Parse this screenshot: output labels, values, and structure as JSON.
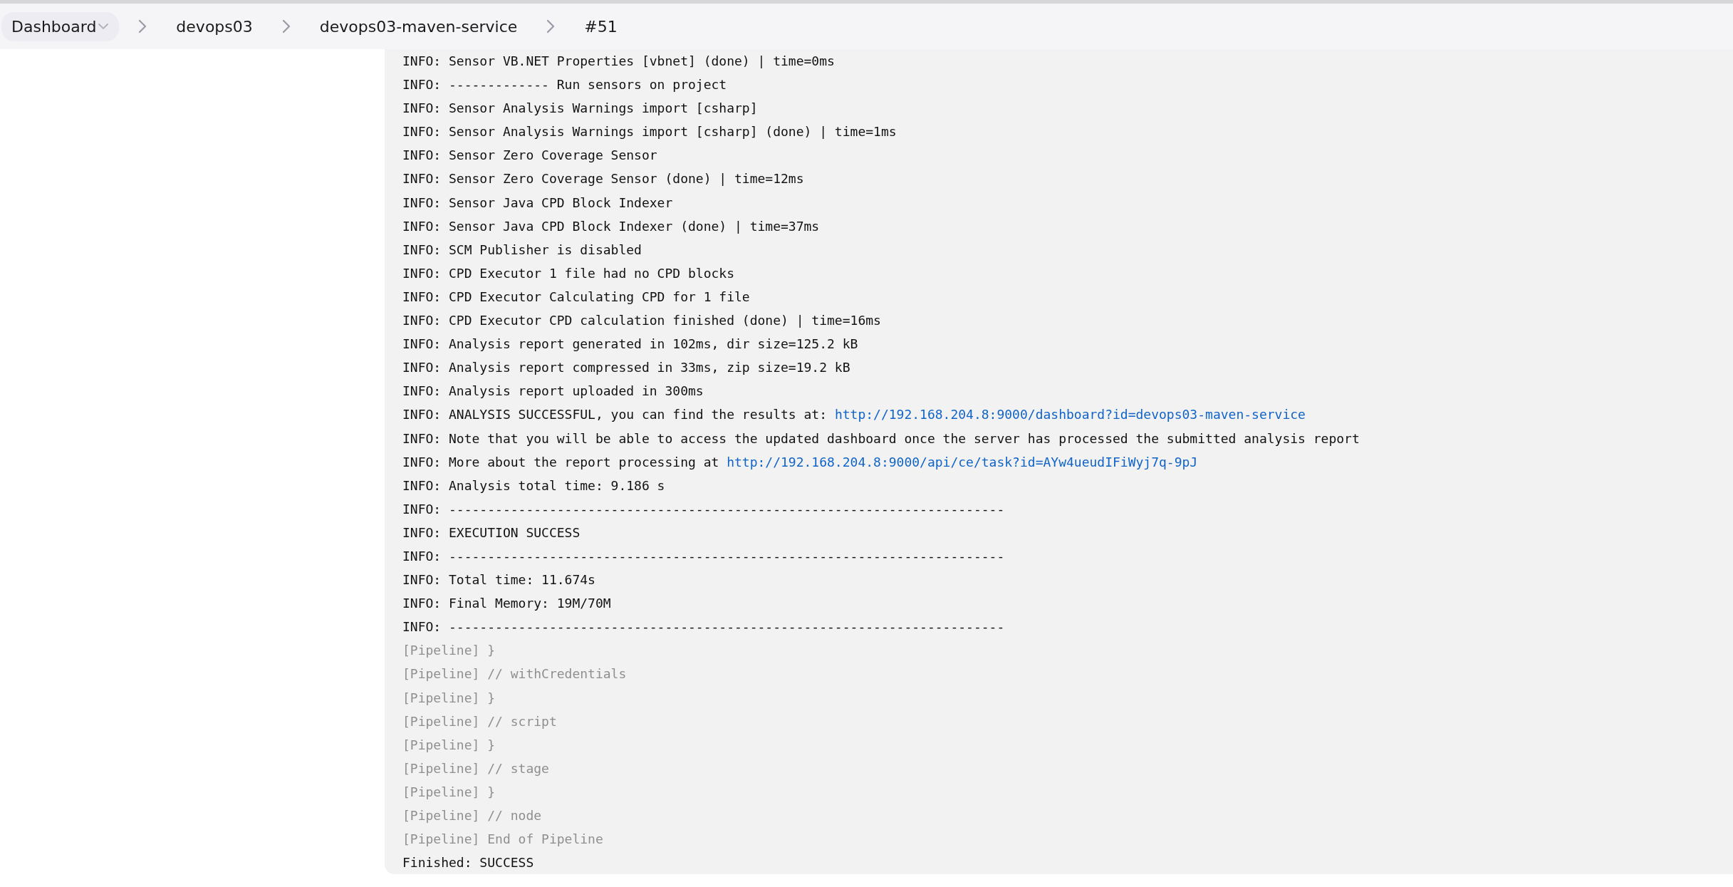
{
  "breadcrumb": [
    {
      "label": "Dashboard",
      "dropdown": true
    },
    {
      "label": "devops03",
      "dropdown": false
    },
    {
      "label": "devops03-maven-service",
      "dropdown": false
    },
    {
      "label": "#51",
      "dropdown": false
    }
  ],
  "console": {
    "lines": [
      {
        "kind": "output",
        "text": "INFO: Sensor VB.NET Properties [vbnet] (done) | time=0ms"
      },
      {
        "kind": "output",
        "text": "INFO: ------------- Run sensors on project"
      },
      {
        "kind": "output",
        "text": "INFO: Sensor Analysis Warnings import [csharp]"
      },
      {
        "kind": "output",
        "text": "INFO: Sensor Analysis Warnings import [csharp] (done) | time=1ms"
      },
      {
        "kind": "output",
        "text": "INFO: Sensor Zero Coverage Sensor"
      },
      {
        "kind": "output",
        "text": "INFO: Sensor Zero Coverage Sensor (done) | time=12ms"
      },
      {
        "kind": "output",
        "text": "INFO: Sensor Java CPD Block Indexer"
      },
      {
        "kind": "output",
        "text": "INFO: Sensor Java CPD Block Indexer (done) | time=37ms"
      },
      {
        "kind": "output",
        "text": "INFO: SCM Publisher is disabled"
      },
      {
        "kind": "output",
        "text": "INFO: CPD Executor 1 file had no CPD blocks"
      },
      {
        "kind": "output",
        "text": "INFO: CPD Executor Calculating CPD for 1 file"
      },
      {
        "kind": "output",
        "text": "INFO: CPD Executor CPD calculation finished (done) | time=16ms"
      },
      {
        "kind": "output",
        "text": "INFO: Analysis report generated in 102ms, dir size=125.2 kB"
      },
      {
        "kind": "output",
        "text": "INFO: Analysis report compressed in 33ms, zip size=19.2 kB"
      },
      {
        "kind": "output",
        "text": "INFO: Analysis report uploaded in 300ms"
      },
      {
        "kind": "output",
        "text": "INFO: ANALYSIS SUCCESSFUL, you can find the results at: ",
        "link": "http://192.168.204.8:9000/dashboard?id=devops03-maven-service"
      },
      {
        "kind": "output",
        "text": "INFO: Note that you will be able to access the updated dashboard once the server has processed the submitted analysis report"
      },
      {
        "kind": "output",
        "text": "INFO: More about the report processing at ",
        "link": "http://192.168.204.8:9000/api/ce/task?id=AYw4ueudIFiWyj7q-9pJ"
      },
      {
        "kind": "output",
        "text": "INFO: Analysis total time: 9.186 s"
      },
      {
        "kind": "output",
        "text": "INFO: ------------------------------------------------------------------------"
      },
      {
        "kind": "output",
        "text": "INFO: EXECUTION SUCCESS"
      },
      {
        "kind": "output",
        "text": "INFO: ------------------------------------------------------------------------"
      },
      {
        "kind": "output",
        "text": "INFO: Total time: 11.674s"
      },
      {
        "kind": "output",
        "text": "INFO: Final Memory: 19M/70M"
      },
      {
        "kind": "output",
        "text": "INFO: ------------------------------------------------------------------------"
      },
      {
        "kind": "pipeline",
        "text": "[Pipeline] }"
      },
      {
        "kind": "pipeline",
        "text": "[Pipeline] // withCredentials"
      },
      {
        "kind": "pipeline",
        "text": "[Pipeline] }"
      },
      {
        "kind": "pipeline",
        "text": "[Pipeline] // script"
      },
      {
        "kind": "pipeline",
        "text": "[Pipeline] }"
      },
      {
        "kind": "pipeline",
        "text": "[Pipeline] // stage"
      },
      {
        "kind": "pipeline",
        "text": "[Pipeline] }"
      },
      {
        "kind": "pipeline",
        "text": "[Pipeline] // node"
      },
      {
        "kind": "pipeline",
        "text": "[Pipeline] End of Pipeline"
      },
      {
        "kind": "output",
        "text": "Finished: SUCCESS"
      }
    ]
  }
}
